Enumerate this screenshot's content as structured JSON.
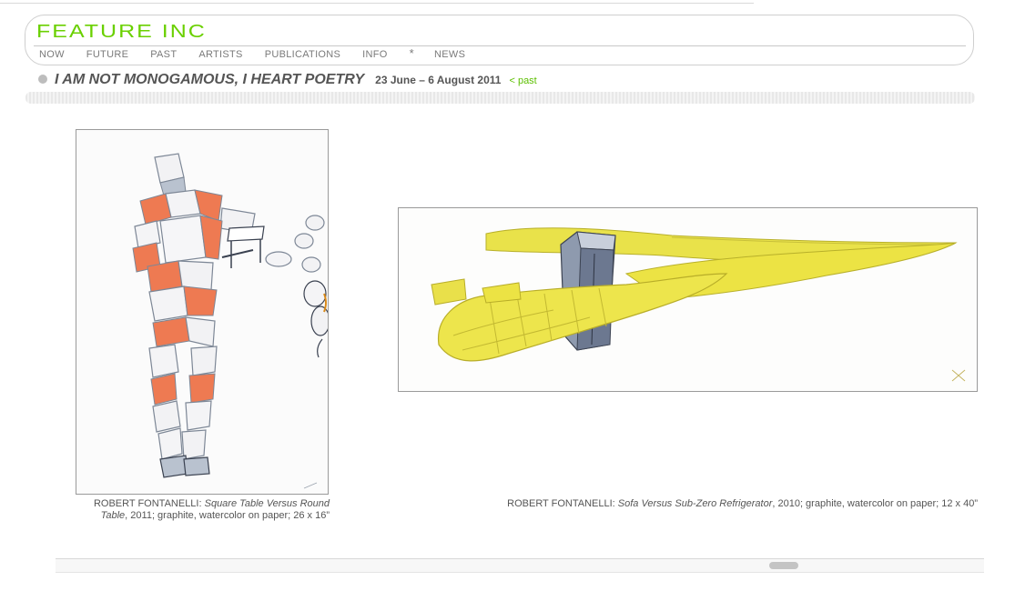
{
  "site": {
    "logo_text": "FEATURE INC",
    "brand_color": "#6ad000"
  },
  "nav": {
    "items": [
      "NOW",
      "FUTURE",
      "PAST",
      "ARTISTS",
      "PUBLICATIONS",
      "INFO",
      "*",
      "NEWS"
    ]
  },
  "show": {
    "title": "I AM NOT MONOGAMOUS, I HEART POETRY",
    "dates": "23 June – 6 August 2011",
    "past_link": "< past"
  },
  "artworks": [
    {
      "image_icon": "abstract-figure-artwork",
      "artist": "ROBERT FONTANELLI:",
      "title": "Square Table Versus Round Table",
      "details": ", 2011; graphite, watercolor on paper; 26 x 16”"
    },
    {
      "image_icon": "yellow-sofa-artwork",
      "artist": "ROBERT FONTANELLI:",
      "title": "Sofa Versus Sub-Zero Refrigerator",
      "details": ", 2010; graphite, watercolor on paper; 12 x 40”"
    }
  ]
}
